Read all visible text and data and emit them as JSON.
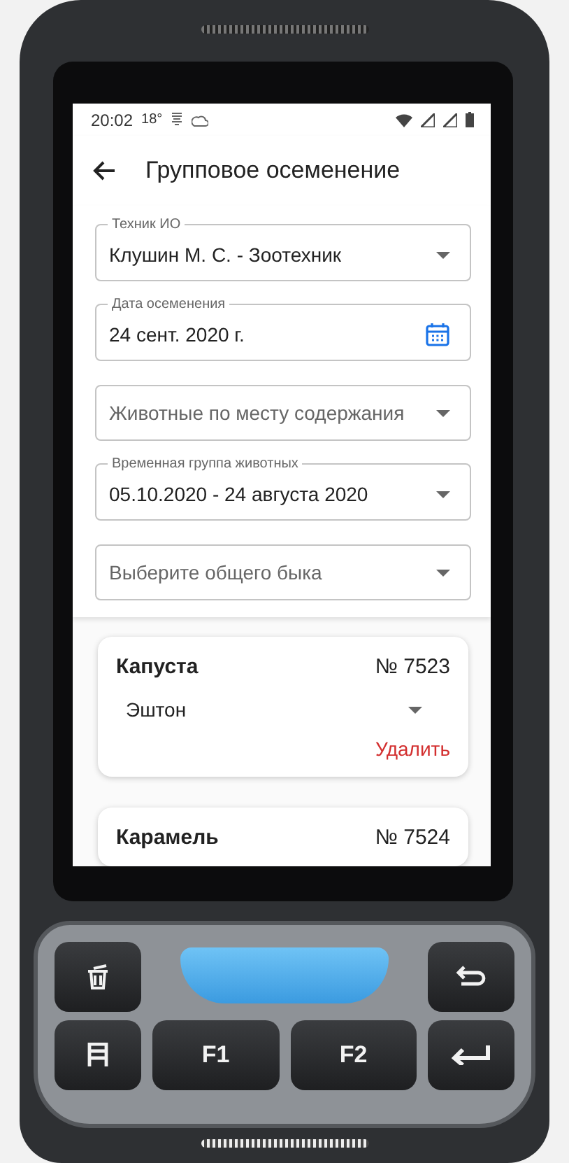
{
  "status_bar": {
    "time": "20:02",
    "temperature": "18°"
  },
  "app_bar": {
    "title": "Групповое осеменение"
  },
  "fields": [
    {
      "kind": "select",
      "label": "Техник ИО",
      "value": "Клушин М. С. - Зоотехник"
    },
    {
      "kind": "date",
      "label": "Дата осеменения",
      "value": "24 сент. 2020 г."
    },
    {
      "kind": "select",
      "placeholder": "Животные по месту содержания"
    },
    {
      "kind": "select",
      "label": "Временная группа животных",
      "value": "05.10.2020 - 24 августа 2020"
    },
    {
      "kind": "select",
      "placeholder": "Выберите общего быка"
    }
  ],
  "animals": [
    {
      "name": "Капуста",
      "number": "№ 7523",
      "bull": "Эштон",
      "action": "Удалить"
    },
    {
      "name": "Карамель",
      "number": "№ 7524"
    }
  ],
  "keypad": {
    "function_keys": [
      "F1",
      "F2"
    ]
  }
}
